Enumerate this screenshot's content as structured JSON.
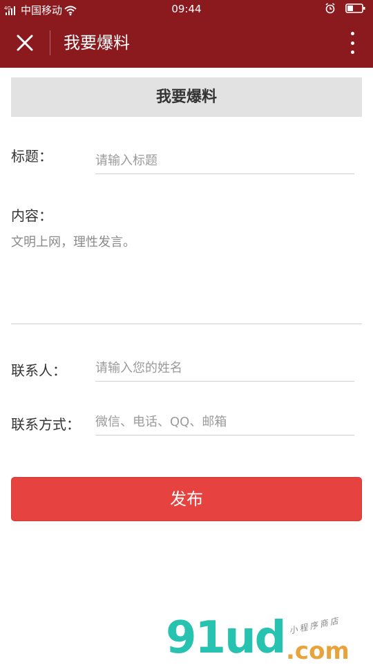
{
  "status_bar": {
    "network": "4G",
    "carrier": "中国移动",
    "time": "09:44"
  },
  "navbar": {
    "title": "我要爆料",
    "background": "#8b1a1f"
  },
  "section": {
    "heading": "我要爆料"
  },
  "form": {
    "title_label": "标题：",
    "title_placeholder": "请输入标题",
    "content_label": "内容：",
    "content_placeholder": "文明上网，理性发言。",
    "contact_label": "联系人：",
    "contact_placeholder": "请输入您的姓名",
    "method_label": "联系方式：",
    "method_placeholder": "微信、电话、QQ、邮箱"
  },
  "submit": {
    "label": "发布",
    "color": "#e64340"
  },
  "watermark": {
    "main": "91ud",
    "suffix": ".com",
    "tagline": "小程序商店"
  }
}
